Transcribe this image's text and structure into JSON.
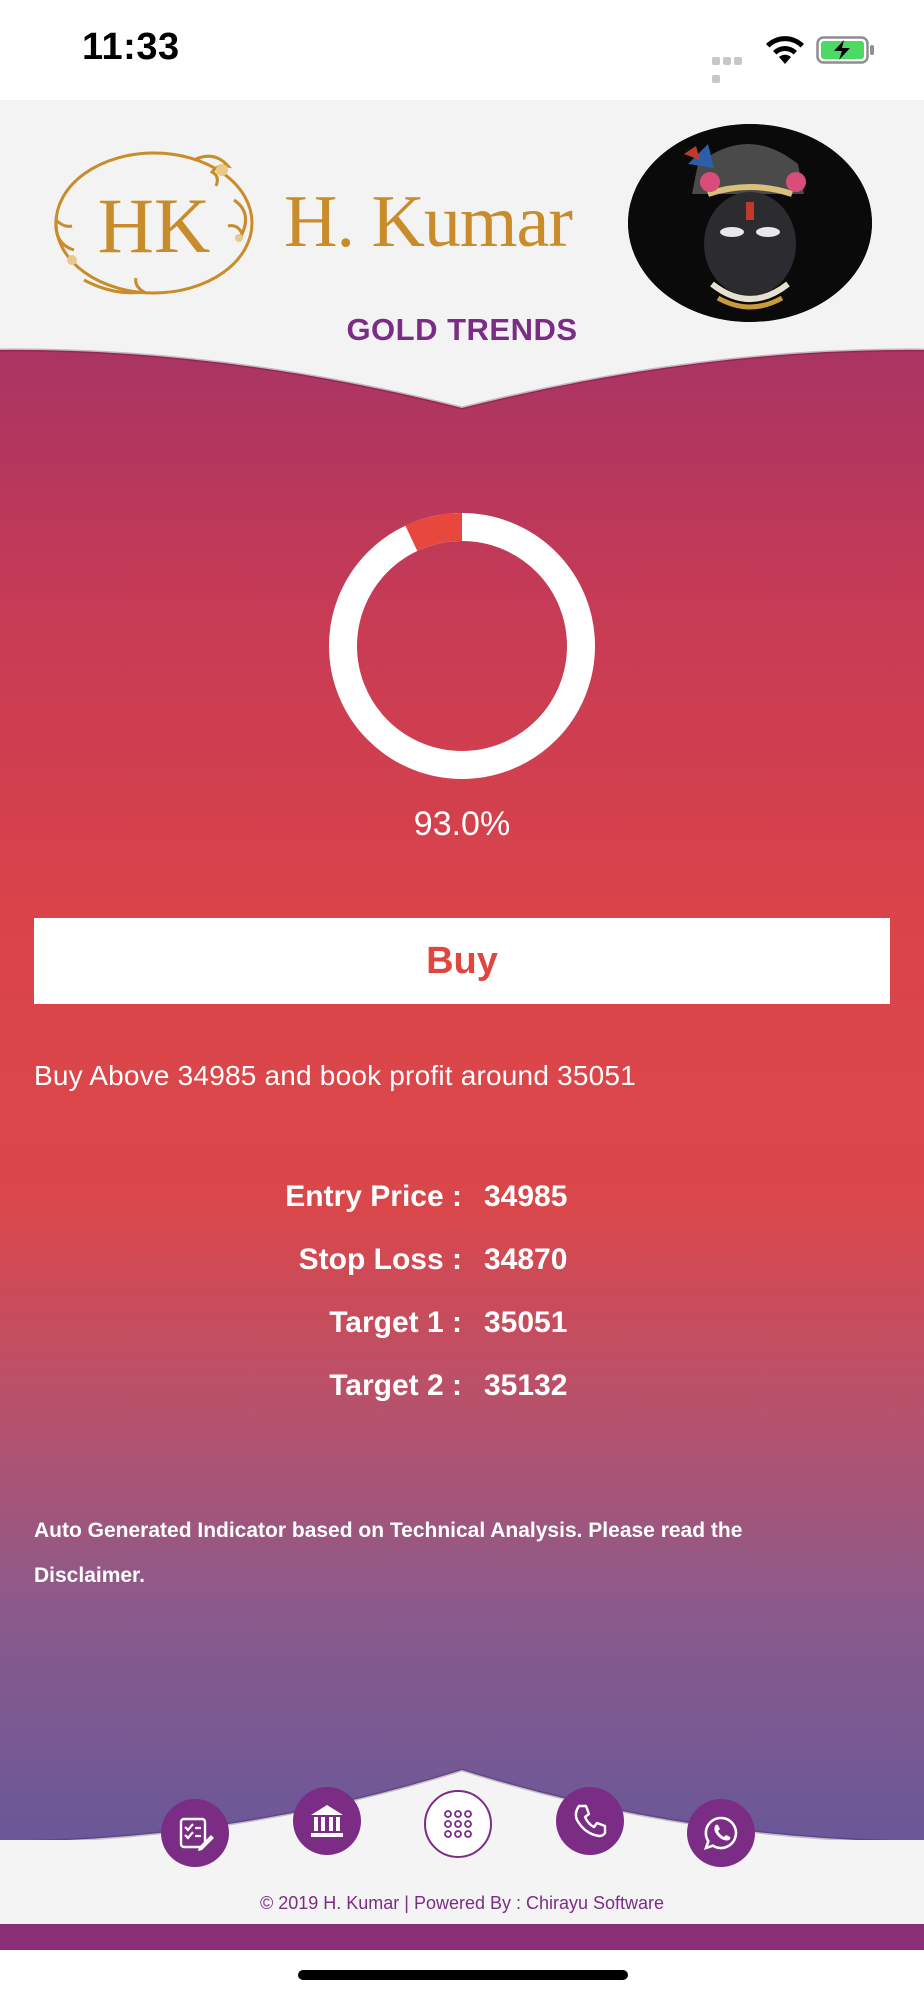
{
  "status_bar": {
    "time": "11:33"
  },
  "header": {
    "logo_monogram": "HK",
    "brand_name": "H. Kumar",
    "section_title": "GOLD TRENDS"
  },
  "indicator": {
    "percent_label": "93.0%",
    "value_fraction": 0.93,
    "ring_color": "#ffffff",
    "remainder_color": "#e8473e"
  },
  "signal": {
    "button_label": "Buy",
    "instruction": "Buy Above 34985 and book profit around 35051"
  },
  "details": [
    {
      "label": "Entry Price :",
      "value": "34985"
    },
    {
      "label": "Stop Loss :",
      "value": "34870"
    },
    {
      "label": "Target 1 :",
      "value": "35051"
    },
    {
      "label": "Target 2 :",
      "value": "35132"
    }
  ],
  "disclaimer": "Auto Generated Indicator based on Technical Analysis. Please read the Disclaimer.",
  "bottom_nav": {
    "items": [
      {
        "icon": "checklist-edit-icon"
      },
      {
        "icon": "bank-icon"
      },
      {
        "icon": "grid-menu-icon"
      },
      {
        "icon": "phone-icon"
      },
      {
        "icon": "whatsapp-icon"
      }
    ]
  },
  "footer": {
    "copyright": "©  2019 H. Kumar | Powered By : Chirayu Software"
  },
  "colors": {
    "brand_purple": "#7b2c85",
    "brand_gold": "#c88c2a",
    "accent_red": "#e0463e"
  }
}
